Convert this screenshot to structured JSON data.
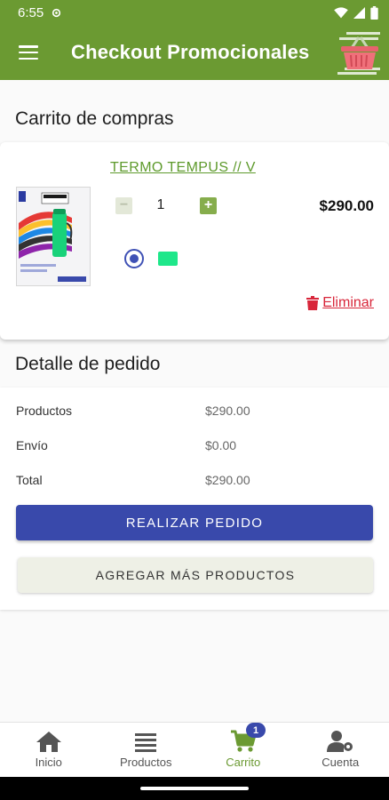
{
  "status_bar": {
    "time": "6:55",
    "icons": [
      "settings-gear-icon",
      "wifi-icon",
      "signal-icon",
      "battery-icon"
    ]
  },
  "app_bar": {
    "title": "Checkout Promocionales",
    "menu_icon": "hamburger-menu-icon",
    "logo_icon": "shopping-basket-icon"
  },
  "cart": {
    "section_title": "Carrito de compras",
    "items": [
      {
        "name": "TERMO TEMPUS // V",
        "image_icon": "thermos-product-image",
        "quantity": "1",
        "price": "$290.00",
        "color_hex": "#1ee78a",
        "delete_label": " Eliminar"
      }
    ]
  },
  "order_detail": {
    "section_title": "Detalle de pedido",
    "rows": [
      {
        "label": "Productos",
        "value": "$290.00"
      },
      {
        "label": "Envío",
        "value": "$0.00"
      },
      {
        "label": "Total",
        "value": "$290.00"
      }
    ],
    "place_order_label": "REALIZAR PEDIDO",
    "add_more_label": "AGREGAR MÁS PRODUCTOS"
  },
  "bottom_nav": {
    "items": [
      {
        "label": "Inicio",
        "icon": "home-icon"
      },
      {
        "label": "Productos",
        "icon": "list-icon"
      },
      {
        "label": "Carrito",
        "icon": "cart-icon",
        "badge": "1",
        "active": true
      },
      {
        "label": "Cuenta",
        "icon": "user-settings-icon"
      }
    ]
  },
  "colors": {
    "brand_green": "#6b9a32",
    "primary_blue": "#3949ab",
    "delete_red": "#d8263a"
  }
}
